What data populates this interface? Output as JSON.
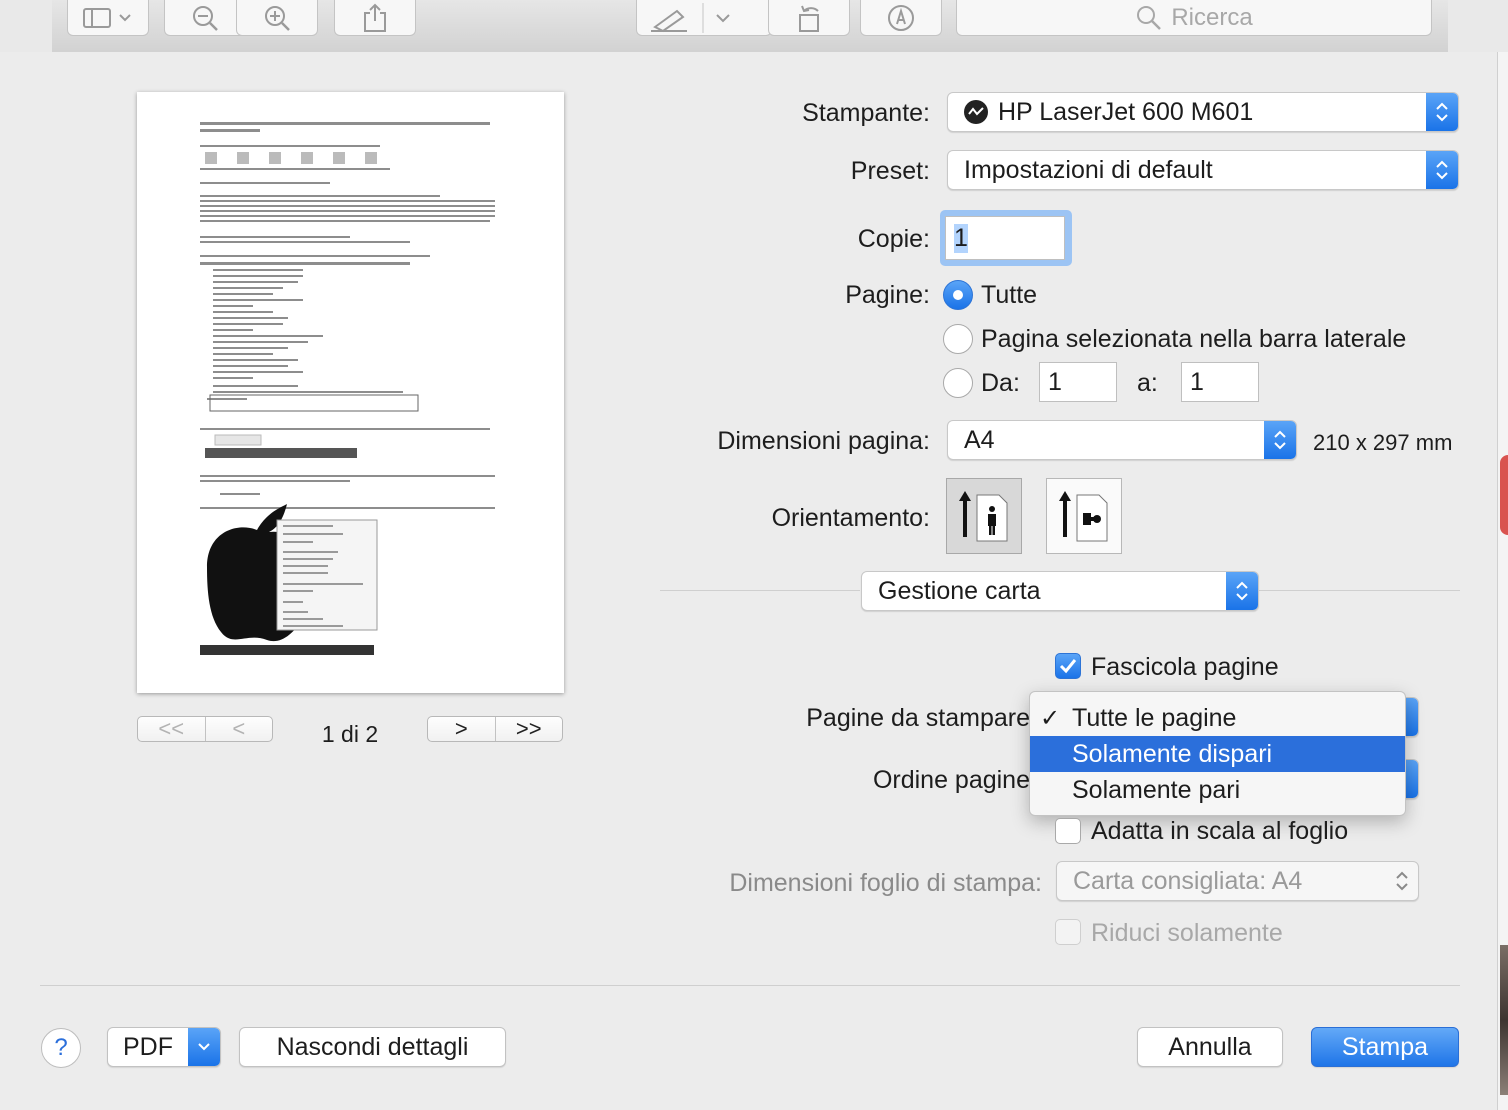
{
  "toolbar": {
    "search_placeholder": "Ricerca",
    "icons": [
      "sidebar-icon",
      "zoom-out-icon",
      "zoom-in-icon",
      "share-icon",
      "highlight-icon",
      "rotate-icon",
      "markup-icon",
      "search-icon"
    ]
  },
  "printer": {
    "label": "Stampante:",
    "value": "HP LaserJet 600 M601"
  },
  "preset": {
    "label": "Preset:",
    "value": "Impostazioni di default"
  },
  "copies": {
    "label": "Copie:",
    "value": "1"
  },
  "pages": {
    "label": "Pagine:",
    "all": "Tutte",
    "selected_sidebar": "Pagina selezionata nella barra laterale",
    "from_label": "Da:",
    "from_value": "1",
    "to_label": "a:",
    "to_value": "1"
  },
  "paper_size": {
    "label": "Dimensioni pagina:",
    "value": "A4",
    "dimensions": "210 x 297 mm"
  },
  "orientation": {
    "label": "Orientamento:"
  },
  "section": {
    "value": "Gestione carta"
  },
  "collate": {
    "label": "Fascicola pagine"
  },
  "pages_to_print": {
    "label": "Pagine da stampare",
    "options": [
      "Tutte le pagine",
      "Solamente dispari",
      "Solamente pari"
    ]
  },
  "page_order": {
    "label": "Ordine pagine"
  },
  "scale_to_fit": {
    "label": "Adatta in scala al foglio"
  },
  "dest_paper": {
    "label": "Dimensioni foglio di stampa:",
    "value": "Carta consigliata: A4"
  },
  "reduce_only": {
    "label": "Riduci solamente"
  },
  "preview": {
    "page_indicator": "1 di 2"
  },
  "footer": {
    "help": "?",
    "pdf": "PDF",
    "hide_details": "Nascondi dettagli",
    "cancel": "Annulla",
    "print": "Stampa"
  },
  "colors": {
    "accent": "#1a73e8",
    "highlight": "#2b6fdb"
  }
}
